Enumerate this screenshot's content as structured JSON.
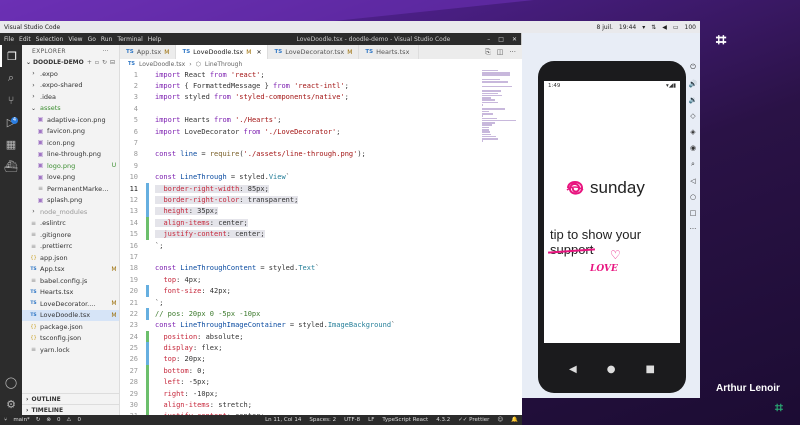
{
  "os_bar": {
    "app_name": "Visual Studio Code",
    "date": "8 juil.",
    "time": "19:44",
    "battery": "100"
  },
  "window": {
    "menu": [
      "File",
      "Edit",
      "Selection",
      "View",
      "Go",
      "Run",
      "Terminal",
      "Help"
    ],
    "title": "LoveDoodle.tsx - doodle-demo - Visual Studio Code"
  },
  "activity_icons": [
    "files-icon",
    "search-icon",
    "source-control-icon",
    "run-debug-icon",
    "extensions-icon",
    "docker-icon"
  ],
  "scm_badge": "4",
  "sidebar": {
    "header": "EXPLORER",
    "project": "DOODLE-DEMO",
    "items": [
      {
        "name": ".expo",
        "type": "folder",
        "indent": 1,
        "status": ""
      },
      {
        "name": ".expo-shared",
        "type": "folder",
        "indent": 1,
        "status": ""
      },
      {
        "name": ".idea",
        "type": "folder",
        "indent": 1,
        "status": ""
      },
      {
        "name": "assets",
        "type": "folder-open",
        "indent": 1,
        "status": "",
        "green": true
      },
      {
        "name": "adaptive-icon.png",
        "type": "file",
        "indent": 2,
        "status": ""
      },
      {
        "name": "favicon.png",
        "type": "file",
        "indent": 2,
        "status": ""
      },
      {
        "name": "icon.png",
        "type": "file",
        "indent": 2,
        "status": ""
      },
      {
        "name": "line-through.png",
        "type": "file",
        "indent": 2,
        "status": ""
      },
      {
        "name": "logo.png",
        "type": "file",
        "indent": 2,
        "status": "U",
        "green": true
      },
      {
        "name": "love.png",
        "type": "file",
        "indent": 2,
        "status": ""
      },
      {
        "name": "PermanentMarker-...",
        "type": "file",
        "indent": 2,
        "status": ""
      },
      {
        "name": "splash.png",
        "type": "file",
        "indent": 2,
        "status": ""
      },
      {
        "name": "node_modules",
        "type": "folder",
        "indent": 1,
        "status": "",
        "dim": true
      },
      {
        "name": ".eslintrc",
        "type": "file",
        "indent": 1,
        "status": ""
      },
      {
        "name": ".gitignore",
        "type": "file",
        "indent": 1,
        "status": ""
      },
      {
        "name": ".prettierrc",
        "type": "file",
        "indent": 1,
        "status": ""
      },
      {
        "name": "app.json",
        "type": "file",
        "indent": 1,
        "status": ""
      },
      {
        "name": "App.tsx",
        "type": "file",
        "indent": 1,
        "status": "M"
      },
      {
        "name": "babel.config.js",
        "type": "file",
        "indent": 1,
        "status": ""
      },
      {
        "name": "Hearts.tsx",
        "type": "file",
        "indent": 1,
        "status": ""
      },
      {
        "name": "LoveDecorator....",
        "type": "file",
        "indent": 1,
        "status": "M"
      },
      {
        "name": "LoveDoodle.tsx",
        "type": "file",
        "indent": 1,
        "status": "M",
        "selected": true
      },
      {
        "name": "package.json",
        "type": "file",
        "indent": 1,
        "status": ""
      },
      {
        "name": "tsconfig.json",
        "type": "file",
        "indent": 1,
        "status": ""
      },
      {
        "name": "yarn.lock",
        "type": "file",
        "indent": 1,
        "status": ""
      }
    ],
    "outline": "OUTLINE",
    "timeline": "TIMELINE"
  },
  "tabs": [
    {
      "label": "App.tsx",
      "mod": "M",
      "active": false
    },
    {
      "label": "LoveDoodle.tsx",
      "mod": "M",
      "active": true
    },
    {
      "label": "LoveDecorator.tsx",
      "mod": "M",
      "active": false
    },
    {
      "label": "Hearts.tsx",
      "mod": "",
      "active": false
    }
  ],
  "breadcrumb": {
    "file": "LoveDoodle.tsx",
    "symbol": "LineThrough"
  },
  "code": {
    "start_line": 1,
    "current_line": 11,
    "highlight_lines": [
      11,
      12,
      13,
      14,
      15
    ],
    "gutter": {
      "11": "mod",
      "12": "mod",
      "13": "mod",
      "14": "add",
      "15": "add",
      "20": "mod",
      "22": "mod",
      "24": "add",
      "25": "mod",
      "26": "mod",
      "27": "add",
      "28": "add",
      "29": "add",
      "30": "add",
      "31": "add"
    },
    "lines": [
      [
        [
          "kw",
          "import"
        ],
        [
          "plain",
          " React "
        ],
        [
          "kw",
          "from"
        ],
        [
          "plain",
          " "
        ],
        [
          "str",
          "'react'"
        ],
        [
          "plain",
          ";"
        ]
      ],
      [
        [
          "kw",
          "import"
        ],
        [
          "plain",
          " { FormattedMessage } "
        ],
        [
          "kw",
          "from"
        ],
        [
          "plain",
          " "
        ],
        [
          "str",
          "'react-intl'"
        ],
        [
          "plain",
          ";"
        ]
      ],
      [
        [
          "kw",
          "import"
        ],
        [
          "plain",
          " styled "
        ],
        [
          "kw",
          "from"
        ],
        [
          "plain",
          " "
        ],
        [
          "str",
          "'styled-components/native'"
        ],
        [
          "plain",
          ";"
        ]
      ],
      [],
      [
        [
          "kw",
          "import"
        ],
        [
          "plain",
          " Hearts "
        ],
        [
          "kw",
          "from"
        ],
        [
          "plain",
          " "
        ],
        [
          "str",
          "'./Hearts'"
        ],
        [
          "plain",
          ";"
        ]
      ],
      [
        [
          "kw",
          "import"
        ],
        [
          "plain",
          " LoveDecorator "
        ],
        [
          "kw",
          "from"
        ],
        [
          "plain",
          " "
        ],
        [
          "str",
          "'./LoveDecorator'"
        ],
        [
          "plain",
          ";"
        ]
      ],
      [],
      [
        [
          "kw",
          "const"
        ],
        [
          "plain",
          " "
        ],
        [
          "id",
          "line"
        ],
        [
          "plain",
          " = "
        ],
        [
          "fn",
          "require"
        ],
        [
          "plain",
          "("
        ],
        [
          "str",
          "'./assets/line-through.png'"
        ],
        [
          "plain",
          ");"
        ]
      ],
      [],
      [
        [
          "kw",
          "const"
        ],
        [
          "plain",
          " "
        ],
        [
          "id",
          "LineThrough"
        ],
        [
          "plain",
          " = styled."
        ],
        [
          "ty",
          "View"
        ],
        [
          "plain",
          "`"
        ]
      ],
      [
        [
          "plain",
          "  "
        ],
        [
          "pr",
          "border-right-width"
        ],
        [
          "plain",
          ": 85px;"
        ]
      ],
      [
        [
          "plain",
          "  "
        ],
        [
          "pr",
          "border-right-color"
        ],
        [
          "plain",
          ": transparent;"
        ]
      ],
      [
        [
          "plain",
          "  "
        ],
        [
          "pr",
          "height"
        ],
        [
          "plain",
          ": 35px;"
        ]
      ],
      [
        [
          "plain",
          "  "
        ],
        [
          "pr",
          "align-items"
        ],
        [
          "plain",
          ": center;"
        ]
      ],
      [
        [
          "plain",
          "  "
        ],
        [
          "pr",
          "justify-content"
        ],
        [
          "plain",
          ": center;"
        ]
      ],
      [
        [
          "plain",
          "`;"
        ]
      ],
      [],
      [
        [
          "kw",
          "const"
        ],
        [
          "plain",
          " "
        ],
        [
          "id",
          "LineThroughContent"
        ],
        [
          "plain",
          " = styled."
        ],
        [
          "ty",
          "Text"
        ],
        [
          "plain",
          "`"
        ]
      ],
      [
        [
          "plain",
          "  "
        ],
        [
          "pr",
          "top"
        ],
        [
          "plain",
          ": 4px;"
        ]
      ],
      [
        [
          "plain",
          "  "
        ],
        [
          "pr",
          "font-size"
        ],
        [
          "plain",
          ": 42px;"
        ]
      ],
      [
        [
          "plain",
          "`;"
        ]
      ],
      [
        [
          "cm",
          "// pos: 20px 0 -5px -10px"
        ]
      ],
      [
        [
          "kw",
          "const"
        ],
        [
          "plain",
          " "
        ],
        [
          "id",
          "LineThroughImageContainer"
        ],
        [
          "plain",
          " = styled."
        ],
        [
          "ty",
          "ImageBackground"
        ],
        [
          "plain",
          "`"
        ]
      ],
      [
        [
          "plain",
          "  "
        ],
        [
          "pr",
          "position"
        ],
        [
          "plain",
          ": absolute;"
        ]
      ],
      [
        [
          "plain",
          "  "
        ],
        [
          "pr",
          "display"
        ],
        [
          "plain",
          ": flex;"
        ]
      ],
      [
        [
          "plain",
          "  "
        ],
        [
          "pr",
          "top"
        ],
        [
          "plain",
          ": 20px;"
        ]
      ],
      [
        [
          "plain",
          "  "
        ],
        [
          "pr",
          "bottom"
        ],
        [
          "plain",
          ": 0;"
        ]
      ],
      [
        [
          "plain",
          "  "
        ],
        [
          "pr",
          "left"
        ],
        [
          "plain",
          ": -5px;"
        ]
      ],
      [
        [
          "plain",
          "  "
        ],
        [
          "pr",
          "right"
        ],
        [
          "plain",
          ": -10px;"
        ]
      ],
      [
        [
          "plain",
          "  "
        ],
        [
          "pr",
          "align-items"
        ],
        [
          "plain",
          ": stretch;"
        ]
      ],
      [
        [
          "plain",
          "  "
        ],
        [
          "pr",
          "justify-content"
        ],
        [
          "plain",
          ": center;"
        ]
      ],
      [
        [
          "plain",
          "`;"
        ]
      ]
    ]
  },
  "statusbar": {
    "branch": "main*",
    "errors": "0",
    "warnings": "0",
    "position": "Ln 11, Col 14",
    "spaces": "Spaces: 2",
    "encoding": "UTF-8",
    "eol": "LF",
    "language": "TypeScript React",
    "version": "4.3.2",
    "prettier": "Prettier"
  },
  "phone": {
    "time": "1:49",
    "app_logo_text": "sunday",
    "tip_line1": "tip to show your",
    "tip_strike": "support",
    "love": "LOVE"
  },
  "presenter": "Arthur Lenoir"
}
